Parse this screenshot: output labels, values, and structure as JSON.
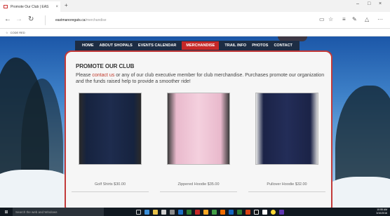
{
  "browser": {
    "tab_title": "Promote Our Club | EAS",
    "tab_close": "×",
    "new_tab": "+",
    "url_domain": "eastmanoregats.ca",
    "url_path": "/merchandise",
    "favorite": "CODE RED",
    "window_minimize": "–",
    "window_maximize": "□",
    "window_close": "×"
  },
  "site": {
    "menu": [
      {
        "label": "HOME",
        "active": false
      },
      {
        "label": "ABOUT SHOPALS",
        "active": false
      },
      {
        "label": "EVENTS CALENDAR",
        "active": false
      },
      {
        "label": "MERCHANDISE",
        "active": true
      },
      {
        "label": "TRAIL INFO",
        "active": false
      },
      {
        "label": "PHOTOS",
        "active": false
      },
      {
        "label": "CONTACT",
        "active": false
      }
    ],
    "heading": "PROMOTE OUR CLUB",
    "desc_pre": "Please ",
    "desc_link": "contact us",
    "desc_post": " or any of  our club executive member for club merchandise. Purchases promote our organization and the funds raised help to provide a smoother ride!",
    "products": [
      {
        "caption": "Golf Shirts $30.00",
        "color": "#16233f"
      },
      {
        "caption": "Zippered Hoodie $35.00",
        "color": "#f1c6d6"
      },
      {
        "caption": "Pullover Hoodie $32.00",
        "color": "#1b2347"
      }
    ]
  },
  "taskbar": {
    "search_placeholder": "Search the web and Windows",
    "time": "10:55 AM",
    "date": "3/10/2016"
  }
}
